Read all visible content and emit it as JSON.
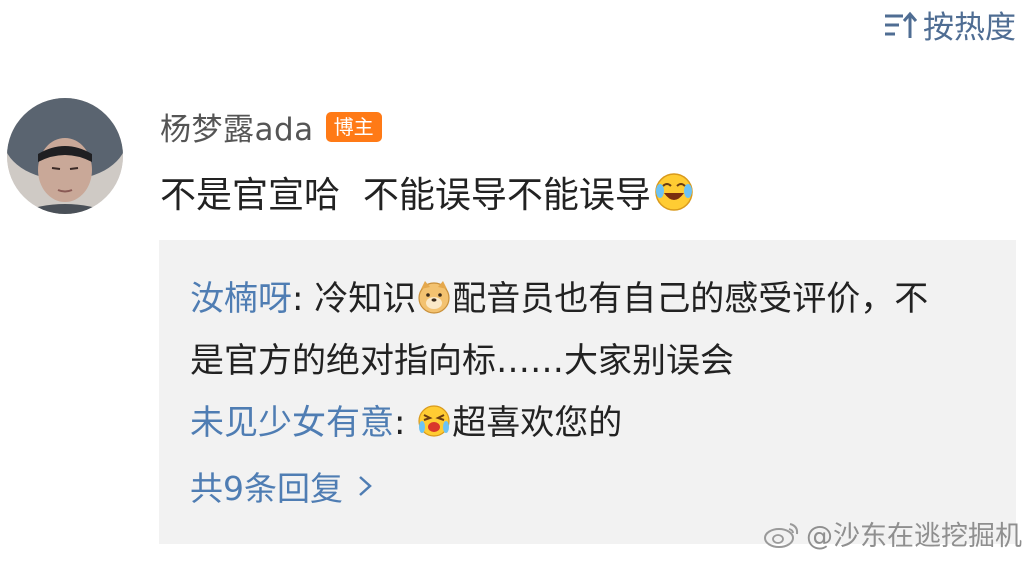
{
  "sort": {
    "label": "按热度",
    "icon": "sort-icon"
  },
  "comment": {
    "avatar_icon": "avatar-photo",
    "author": "杨梦露ada",
    "badge": "博主",
    "text": "不是官宣哈  不能误导不能误导",
    "text_emoji": "laugh-cry-emoji"
  },
  "replies": [
    {
      "user": "汝楠呀",
      "sep": ": ",
      "pre_emoji_text": "冷知识",
      "emoji": "doge-emoji",
      "text": "配音员也有自己的感受评价，不是官方的绝对指向标……大家别误会"
    },
    {
      "user": "未见少女有意",
      "sep": ": ",
      "emoji": "excited-cry-emoji",
      "text": "超喜欢您的"
    }
  ],
  "more_replies": {
    "label": "共9条回复",
    "icon": "chevron-right-icon"
  },
  "watermark": {
    "text": "@沙东在逃挖掘机",
    "icon": "weibo-logo"
  },
  "colors": {
    "link": "#4f7db3",
    "badge": "#ff7a16",
    "reply_bg": "#f2f2f2"
  }
}
